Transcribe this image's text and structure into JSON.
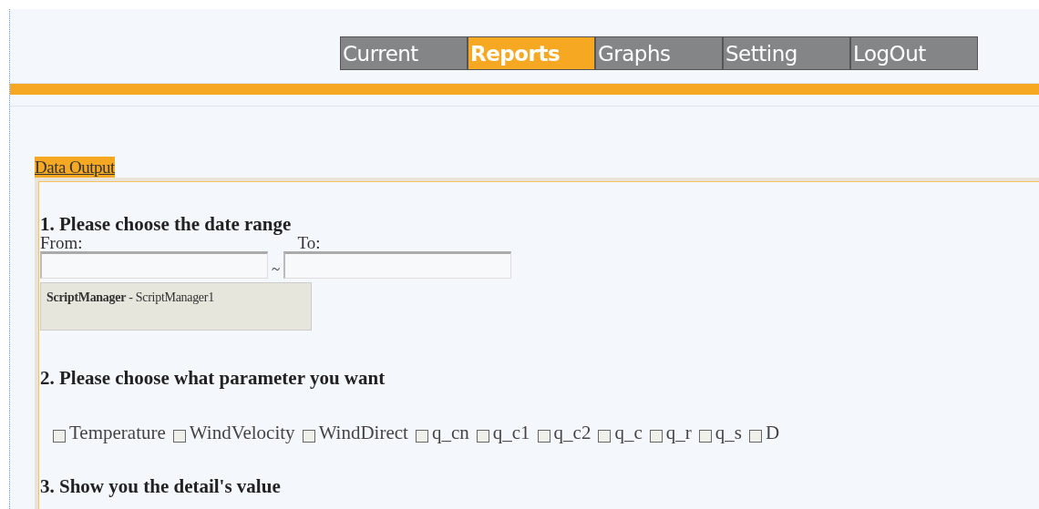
{
  "nav": [
    {
      "label": "Current",
      "selected": false
    },
    {
      "label": "Reports",
      "selected": true
    },
    {
      "label": "Graphs",
      "selected": false
    },
    {
      "label": "Setting",
      "selected": false
    },
    {
      "label": "LogOut",
      "selected": false
    }
  ],
  "section_link": "Data Output",
  "step1": {
    "heading": "1. Please choose the date range",
    "from_label": "From:",
    "to_label": "To:",
    "separator": "~"
  },
  "script_manager": "**ScriptManager** - ScriptManager1",
  "step2": {
    "heading": "2. Please choose what parameter you want",
    "parameters": [
      {
        "label": "Temperature",
        "checked": false
      },
      {
        "label": "WindVelocity",
        "checked": false
      },
      {
        "label": "WindDirect",
        "checked": false
      },
      {
        "label": "q_cn",
        "checked": false
      },
      {
        "label": "q_c1",
        "checked": false
      },
      {
        "label": "q_c2",
        "checked": false
      },
      {
        "label": "q_c",
        "checked": false
      },
      {
        "label": "q_r",
        "checked": false
      },
      {
        "label": "q_s",
        "checked": false
      },
      {
        "label": "D",
        "checked": false
      }
    ]
  },
  "step3": {
    "heading": "3. Show you the detail's value"
  }
}
